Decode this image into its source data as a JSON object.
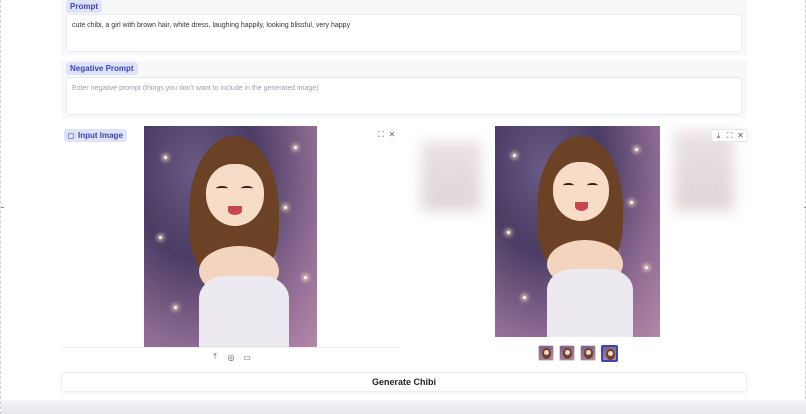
{
  "prompt": {
    "label": "Prompt",
    "value": "cute chibi, a girl with brown hair, white dress, laughing happily, looking blissful, very happy"
  },
  "negative_prompt": {
    "label": "Negative Prompt",
    "placeholder": "Enter negative prompt (things you don't want to include in the generated image)"
  },
  "input_image": {
    "label": "Input Image",
    "controls": {
      "fullscreen": "⛶",
      "close": "✕"
    },
    "toolbar": {
      "upload": "⤒",
      "webcam": "◎",
      "clipboard": "▭"
    }
  },
  "output_gallery": {
    "controls": {
      "download": "⤓",
      "fullscreen": "⛶",
      "close": "✕"
    },
    "thumbnail_count": 4,
    "selected_index": 3
  },
  "generate_button": {
    "label": "Generate Chibi"
  },
  "colors": {
    "accent": "#3b45b5",
    "tag_bg": "#dfe3f7",
    "hair": "#6b4226",
    "background": "#4a3c63"
  }
}
